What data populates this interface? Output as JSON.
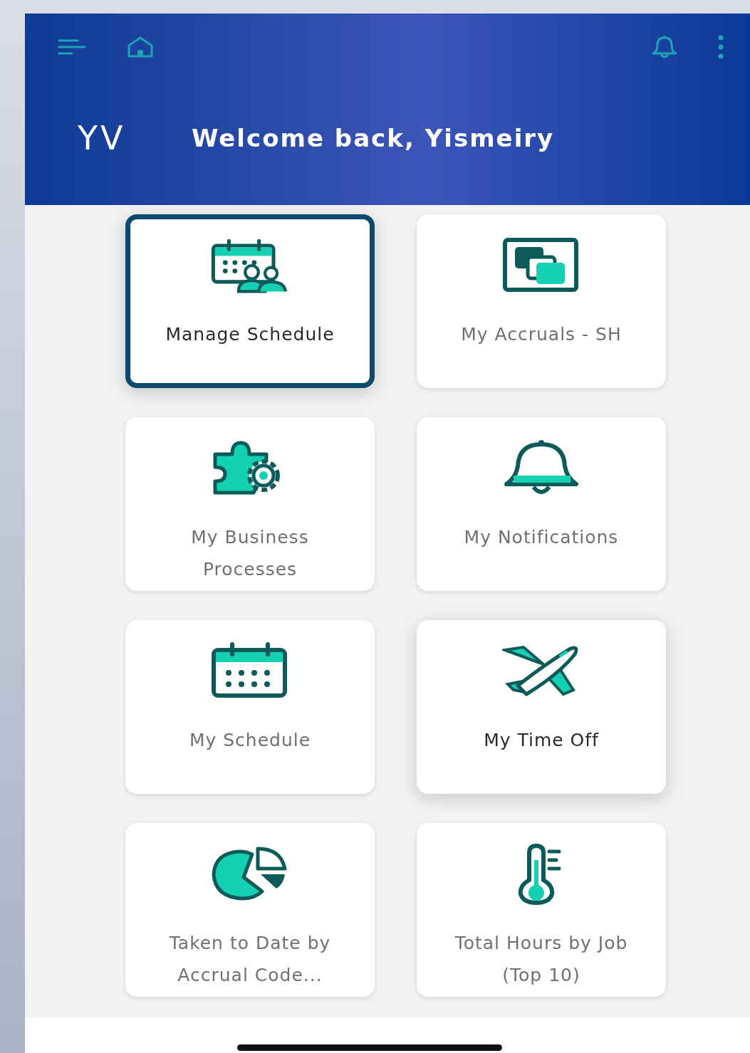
{
  "header": {
    "initials": "YV",
    "greeting": "Welcome back, Yismeiry"
  },
  "tiles": [
    {
      "label": "Manage Schedule",
      "selected": true,
      "highlighted": true
    },
    {
      "label": "My Accruals - SH",
      "selected": false,
      "highlighted": false
    },
    {
      "label": "My Business Processes",
      "selected": false,
      "highlighted": false
    },
    {
      "label": "My Notifications",
      "selected": false,
      "highlighted": false
    },
    {
      "label": "My Schedule",
      "selected": false,
      "highlighted": false
    },
    {
      "label": "My Time Off",
      "selected": false,
      "highlighted": true
    },
    {
      "label": "Taken to Date by Accrual Code...",
      "selected": false,
      "highlighted": false
    },
    {
      "label": "Total Hours by Job (Top 10)",
      "selected": false,
      "highlighted": false
    }
  ]
}
